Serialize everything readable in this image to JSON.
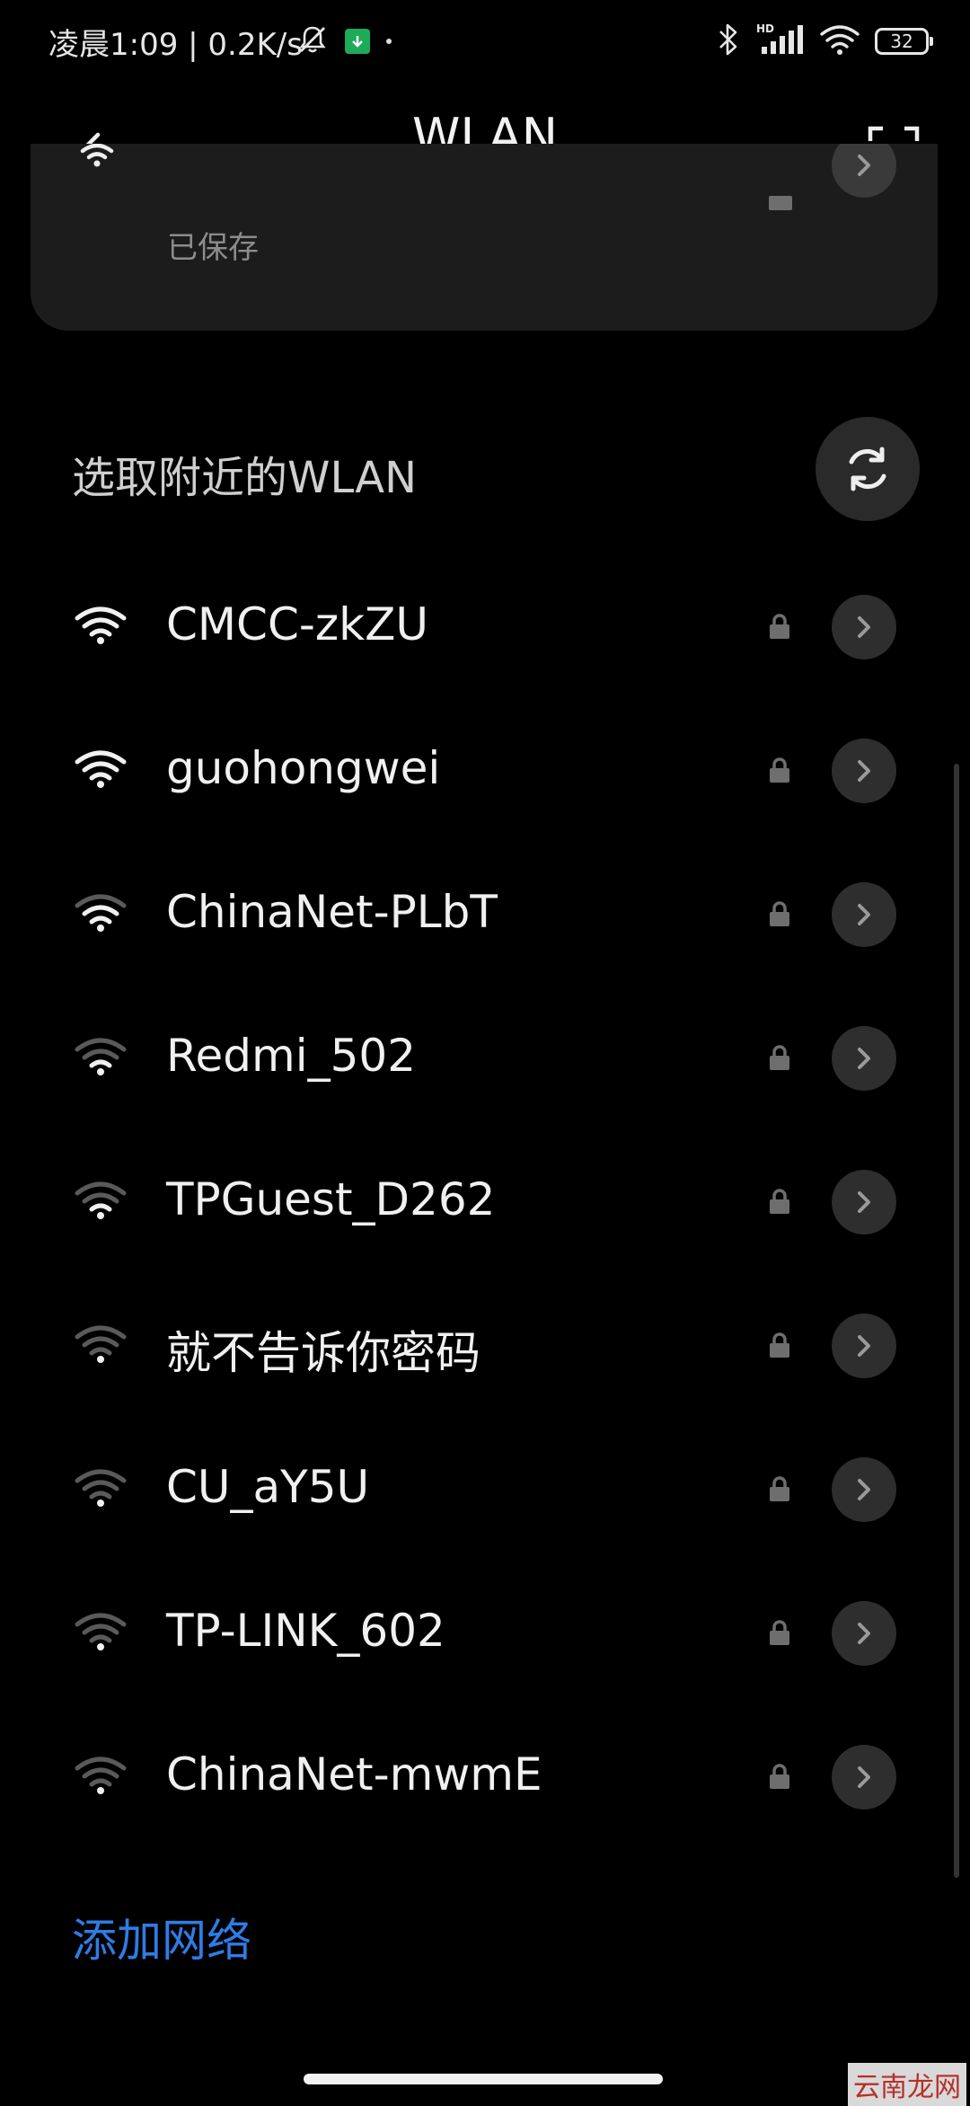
{
  "status_bar": {
    "time_text": "凌晨1:09 | 0.2K/s",
    "icons": [
      "bell-muted-icon",
      "download-icon",
      "dot-icon",
      "bluetooth-icon",
      "hd-signal-icon",
      "wifi-icon",
      "battery-icon"
    ],
    "hd_label": "HD",
    "battery_level": "32",
    "accent_green": "#1faa59"
  },
  "title_bar": {
    "title": "WLAN",
    "back_icon": "arrow-left-icon",
    "scan_icon": "scan-qr-icon"
  },
  "saved_network": {
    "status": "已保存"
  },
  "section": {
    "title": "选取附近的WLAN",
    "refresh_icon": "refresh-icon"
  },
  "networks": [
    {
      "name": "CMCC-zkZU",
      "signal": 4,
      "secured": true
    },
    {
      "name": "guohongwei",
      "signal": 4,
      "secured": true
    },
    {
      "name": "ChinaNet-PLbT",
      "signal": 3,
      "secured": true
    },
    {
      "name": "Redmi_502",
      "signal": 2,
      "secured": true
    },
    {
      "name": "TPGuest_D262",
      "signal": 2,
      "secured": true
    },
    {
      "name": "就不告诉你密码",
      "signal": 1,
      "secured": true
    },
    {
      "name": "CU_aY5U",
      "signal": 1,
      "secured": true
    },
    {
      "name": "TP-LINK_602",
      "signal": 1,
      "secured": true
    },
    {
      "name": "ChinaNet-mwmE",
      "signal": 1,
      "secured": true
    }
  ],
  "add_network": {
    "label": "添加网络",
    "color": "#2f7ce6"
  },
  "watermark": {
    "text": "云南龙网"
  }
}
